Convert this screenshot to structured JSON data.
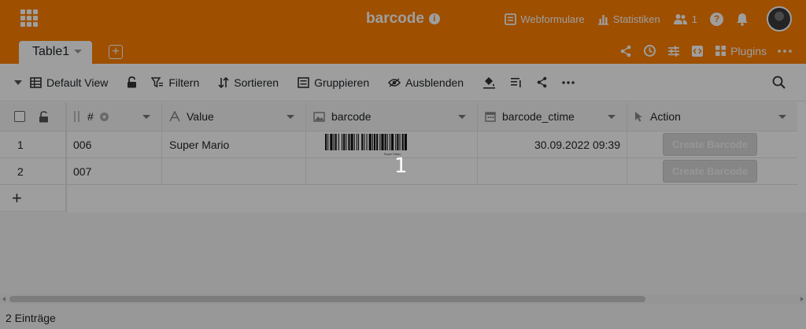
{
  "header": {
    "base_title": "barcode",
    "info_icon": "i",
    "webforms_label": "Webformulare",
    "stats_label": "Statistiken",
    "collaborators_count": "1",
    "help_icon": "?",
    "accent_color": "#ff8000"
  },
  "tabs": {
    "active_table": "Table1",
    "add_tab_label": "+",
    "plugins_label": "Plugins"
  },
  "toolbar": {
    "view_label": "Default View",
    "filter_label": "Filtern",
    "sort_label": "Sortieren",
    "group_label": "Gruppieren",
    "hide_label": "Ausblenden"
  },
  "table": {
    "columns": [
      {
        "label": "#",
        "icon": "id-icon"
      },
      {
        "label": "Value",
        "icon": "text-icon"
      },
      {
        "label": "barcode",
        "icon": "image-icon"
      },
      {
        "label": "barcode_ctime",
        "icon": "calendar-icon"
      },
      {
        "label": "Action",
        "icon": "cursor-icon"
      }
    ],
    "rows": [
      {
        "num": "1",
        "id": "006",
        "value": "Super Mario",
        "has_barcode": true,
        "barcode_caption": "Super Mario",
        "ctime": "30.09.2022 09:39",
        "action": "Create Barcode"
      },
      {
        "num": "2",
        "id": "007",
        "value": "",
        "has_barcode": false,
        "ctime": "",
        "action": "Create Barcode"
      }
    ],
    "add_row_label": "+"
  },
  "footer": {
    "count_label": "2 Einträge"
  },
  "overlay_badge": "1"
}
